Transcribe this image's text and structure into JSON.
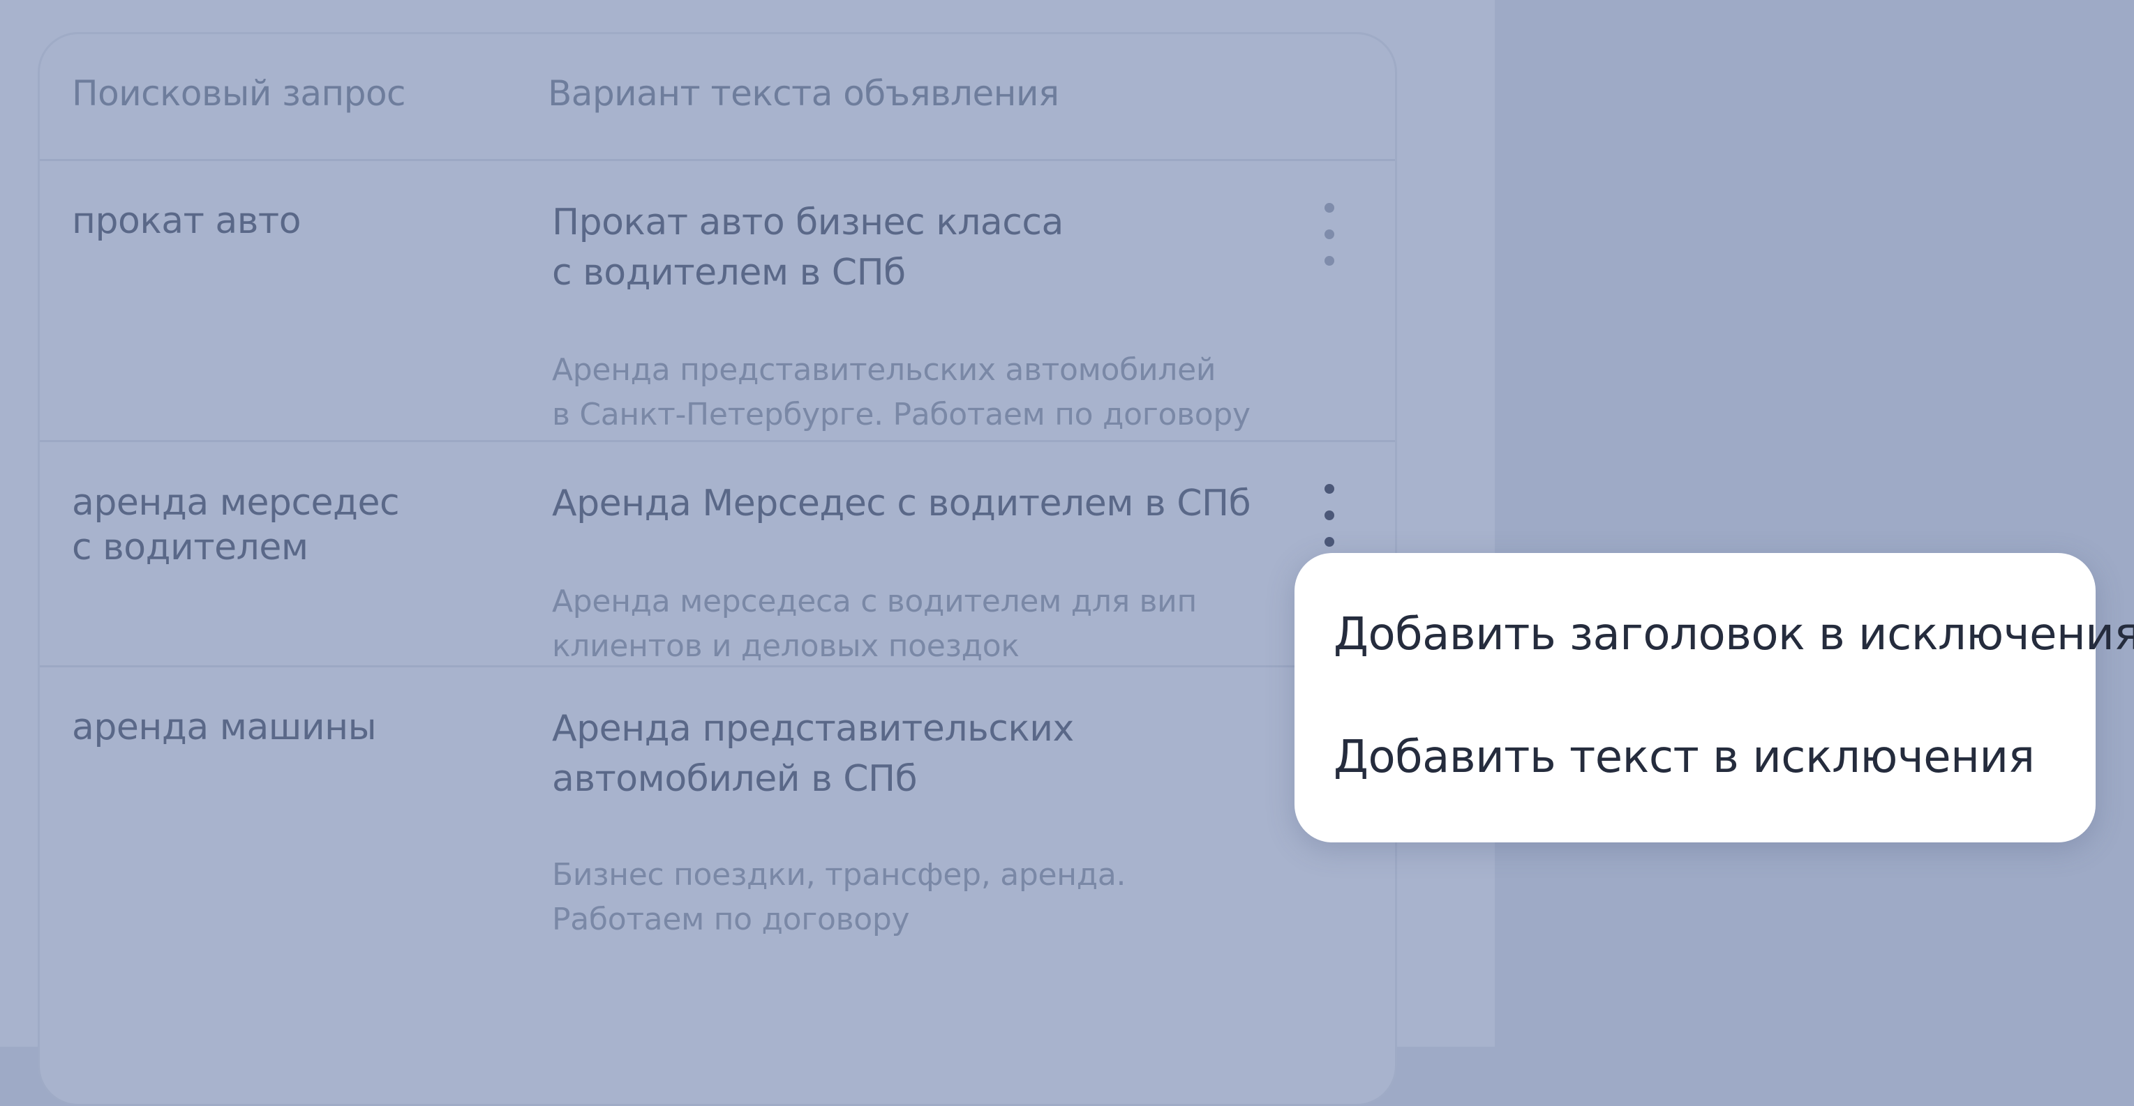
{
  "table": {
    "headers": {
      "query": "Поисковый запрос",
      "ad_variant": "Вариант текста объявления"
    },
    "rows": [
      {
        "query": [
          "прокат авто"
        ],
        "title": [
          "Прокат авто бизнес класса",
          "с водителем в СПб"
        ],
        "text": [
          "Аренда представительских автомобилей",
          "в Санкт-Петербурге. Работаем по договору"
        ]
      },
      {
        "query": [
          "аренда мерседес",
          "с водителем"
        ],
        "title": [
          "Аренда Мерседес с водителем в СПб"
        ],
        "text": [
          "Аренда мерседеса с водителем для вип",
          "клиентов и деловых поездок"
        ]
      },
      {
        "query": [
          "аренда машины"
        ],
        "title": [
          "Аренда представительских",
          "автомобилей в СПб"
        ],
        "text": [
          "Бизнес поездки, трансфер, аренда.",
          "Работаем по договору"
        ]
      }
    ]
  },
  "context_menu": {
    "items": [
      "Добавить заголовок в исключения",
      "Добавить текст в исключения"
    ]
  },
  "icons": {
    "row_menu": "more-vertical-icon"
  },
  "colors": {
    "page_background": "#a8b3cd",
    "menu_background": "#ffffff",
    "menu_text": "#252c3d"
  }
}
